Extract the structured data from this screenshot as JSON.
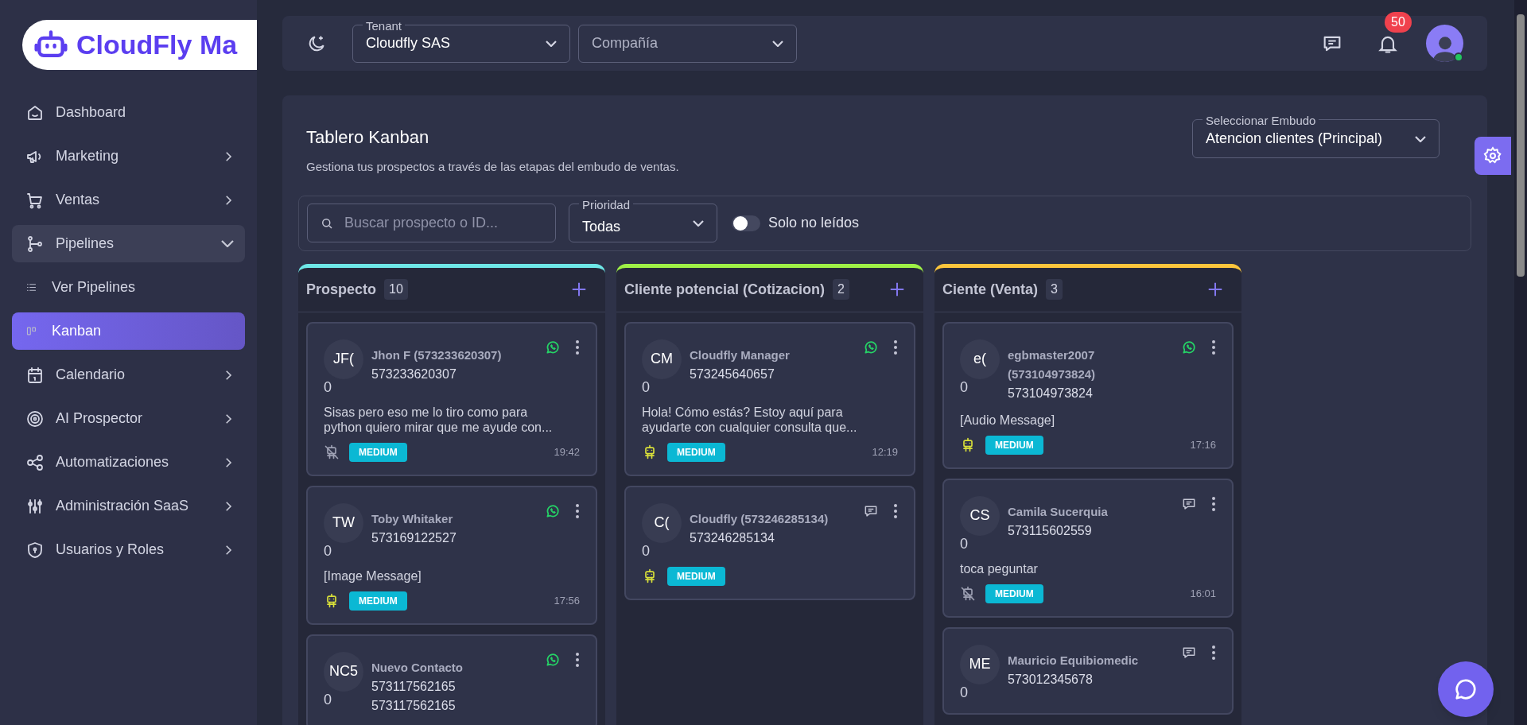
{
  "sidebar": {
    "logo": "CloudFly Ma",
    "items": [
      {
        "label": "Dashboard",
        "kind": "link",
        "expanded": false,
        "selected": false
      },
      {
        "label": "Marketing",
        "kind": "group",
        "expanded": false,
        "selected": false
      },
      {
        "label": "Ventas",
        "kind": "group",
        "expanded": false,
        "selected": false
      },
      {
        "label": "Pipelines",
        "kind": "group",
        "expanded": true,
        "selected": false,
        "children": [
          {
            "label": "Ver Pipelines",
            "selected": false
          },
          {
            "label": "Kanban",
            "selected": true
          }
        ]
      },
      {
        "label": "Calendario",
        "kind": "group",
        "expanded": false,
        "selected": false
      },
      {
        "label": "AI Prospector",
        "kind": "group",
        "expanded": false,
        "selected": false
      },
      {
        "label": "Automatizaciones",
        "kind": "group",
        "expanded": false,
        "selected": false
      },
      {
        "label": "Administración SaaS",
        "kind": "group",
        "expanded": false,
        "selected": false
      },
      {
        "label": "Usuarios y Roles",
        "kind": "group",
        "expanded": false,
        "selected": false
      }
    ]
  },
  "topbar": {
    "tenant": {
      "label": "Tenant",
      "value": "Cloudfly SAS"
    },
    "company": {
      "placeholder": "Compañía"
    },
    "notifications": "50"
  },
  "board": {
    "title": "Tablero Kanban",
    "subtitle": "Gestiona tus prospectos a través de las etapas del embudo de ventas.",
    "funnel": {
      "label": "Seleccionar Embudo",
      "value": "Atencion clientes (Principal)"
    },
    "search": {
      "placeholder": "Buscar prospecto o ID..."
    },
    "priority": {
      "label": "Prioridad",
      "value": "Todas"
    },
    "unread_only": {
      "label": "Solo no leídos",
      "on": false
    }
  },
  "columns": [
    {
      "title": "Prospecto",
      "count": "10",
      "color": "#6ee7e7",
      "cards": [
        {
          "initials": "JF(",
          "score": "0",
          "name": "Jhon F (573233620307)",
          "phones": [
            "573233620307"
          ],
          "message": "Sisas pero eso me lo tiro como para python quiero mirar que me ayude con...",
          "kind": "whatsapp",
          "ai_enabled": false,
          "priority": "MEDIUM",
          "time": "19:42"
        },
        {
          "initials": "TW",
          "score": "0",
          "name": "Toby Whitaker",
          "phones": [
            "573169122527"
          ],
          "message": "[Image Message]",
          "kind": "whatsapp",
          "ai_enabled": true,
          "priority": "MEDIUM",
          "time": "17:56"
        },
        {
          "initials": "NC5",
          "score": "0",
          "name": "Nuevo Contacto",
          "phones": [
            "573117562165",
            "573117562165"
          ],
          "kind": "whatsapp"
        }
      ]
    },
    {
      "title": "Cliente potencial (Cotizacion)",
      "count": "2",
      "color": "#9ef046",
      "cards": [
        {
          "initials": "CM",
          "score": "0",
          "name": "Cloudfly Manager",
          "phones": [
            "573245640657"
          ],
          "message": "Hola! Cómo estás? Estoy aquí para ayudarte con cualquier consulta que...",
          "kind": "whatsapp",
          "ai_enabled": true,
          "priority": "MEDIUM",
          "time": "12:19"
        },
        {
          "initials": "C(",
          "score": "0",
          "name": "Cloudfly (573246285134)",
          "phones": [
            "573246285134"
          ],
          "kind": "chat",
          "ai_enabled": true,
          "priority": "MEDIUM"
        }
      ]
    },
    {
      "title": "Ciente (Venta)",
      "count": "3",
      "color": "#fbc53c",
      "cards": [
        {
          "initials": "e(",
          "score": "0",
          "name": "egbmaster2007 (573104973824)",
          "phones": [
            "573104973824"
          ],
          "message": "[Audio Message]",
          "kind": "whatsapp",
          "ai_enabled": true,
          "priority": "MEDIUM",
          "time": "17:16"
        },
        {
          "initials": "CS",
          "score": "0",
          "name": "Camila Sucerquia",
          "phones": [
            "573115602559"
          ],
          "message": "toca peguntar",
          "kind": "chat",
          "ai_enabled": false,
          "priority": "MEDIUM",
          "time": "16:01"
        },
        {
          "initials": "ME",
          "score": "0",
          "name": "Mauricio Equibiomedic",
          "phones": [
            "573012345678"
          ],
          "kind": "chat"
        }
      ]
    }
  ]
}
